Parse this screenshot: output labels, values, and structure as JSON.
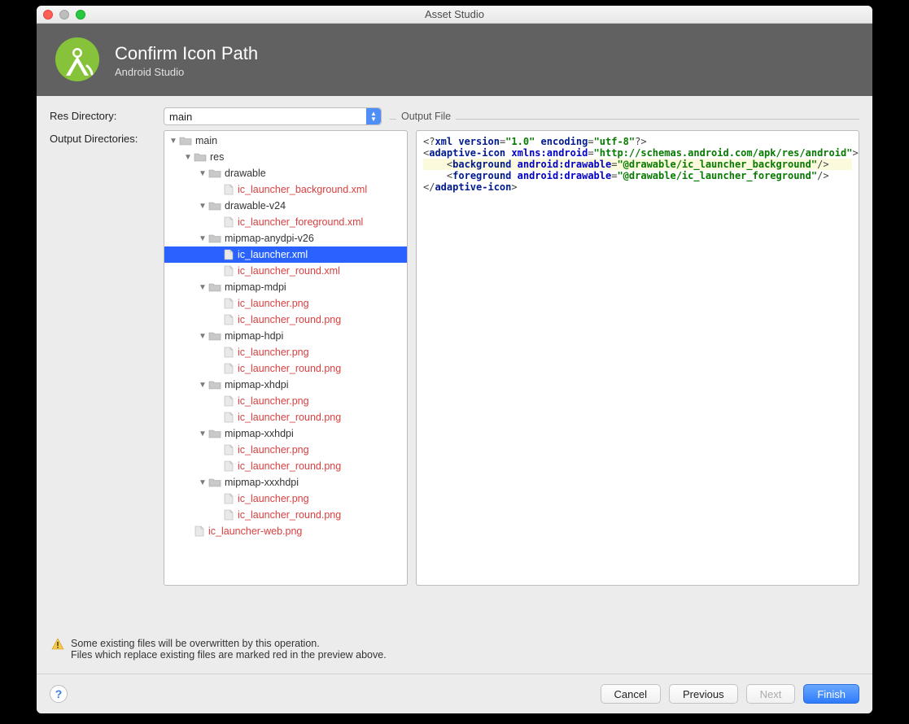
{
  "window": {
    "title": "Asset Studio"
  },
  "banner": {
    "title": "Confirm Icon Path",
    "subtitle": "Android Studio"
  },
  "labels": {
    "res_directory": "Res Directory:",
    "output_directories": "Output Directories:",
    "output_file": "Output File"
  },
  "res_select": {
    "value": "main"
  },
  "tree": [
    {
      "depth": 0,
      "expand": "open",
      "type": "folder",
      "label": "main",
      "red": false
    },
    {
      "depth": 1,
      "expand": "open",
      "type": "folder",
      "label": "res",
      "red": false
    },
    {
      "depth": 2,
      "expand": "open",
      "type": "folder",
      "label": "drawable",
      "red": false
    },
    {
      "depth": 3,
      "expand": "none",
      "type": "file",
      "label": "ic_launcher_background.xml",
      "red": true
    },
    {
      "depth": 2,
      "expand": "open",
      "type": "folder",
      "label": "drawable-v24",
      "red": false
    },
    {
      "depth": 3,
      "expand": "none",
      "type": "file",
      "label": "ic_launcher_foreground.xml",
      "red": true
    },
    {
      "depth": 2,
      "expand": "open",
      "type": "folder",
      "label": "mipmap-anydpi-v26",
      "red": false
    },
    {
      "depth": 3,
      "expand": "none",
      "type": "file",
      "label": "ic_launcher.xml",
      "red": false,
      "selected": true
    },
    {
      "depth": 3,
      "expand": "none",
      "type": "file",
      "label": "ic_launcher_round.xml",
      "red": true
    },
    {
      "depth": 2,
      "expand": "open",
      "type": "folder",
      "label": "mipmap-mdpi",
      "red": false
    },
    {
      "depth": 3,
      "expand": "none",
      "type": "file",
      "label": "ic_launcher.png",
      "red": true
    },
    {
      "depth": 3,
      "expand": "none",
      "type": "file",
      "label": "ic_launcher_round.png",
      "red": true
    },
    {
      "depth": 2,
      "expand": "open",
      "type": "folder",
      "label": "mipmap-hdpi",
      "red": false
    },
    {
      "depth": 3,
      "expand": "none",
      "type": "file",
      "label": "ic_launcher.png",
      "red": true
    },
    {
      "depth": 3,
      "expand": "none",
      "type": "file",
      "label": "ic_launcher_round.png",
      "red": true
    },
    {
      "depth": 2,
      "expand": "open",
      "type": "folder",
      "label": "mipmap-xhdpi",
      "red": false
    },
    {
      "depth": 3,
      "expand": "none",
      "type": "file",
      "label": "ic_launcher.png",
      "red": true
    },
    {
      "depth": 3,
      "expand": "none",
      "type": "file",
      "label": "ic_launcher_round.png",
      "red": true
    },
    {
      "depth": 2,
      "expand": "open",
      "type": "folder",
      "label": "mipmap-xxhdpi",
      "red": false
    },
    {
      "depth": 3,
      "expand": "none",
      "type": "file",
      "label": "ic_launcher.png",
      "red": true
    },
    {
      "depth": 3,
      "expand": "none",
      "type": "file",
      "label": "ic_launcher_round.png",
      "red": true
    },
    {
      "depth": 2,
      "expand": "open",
      "type": "folder",
      "label": "mipmap-xxxhdpi",
      "red": false
    },
    {
      "depth": 3,
      "expand": "none",
      "type": "file",
      "label": "ic_launcher.png",
      "red": true
    },
    {
      "depth": 3,
      "expand": "none",
      "type": "file",
      "label": "ic_launcher_round.png",
      "red": true
    },
    {
      "depth": 1,
      "expand": "none",
      "type": "file",
      "label": "ic_launcher-web.png",
      "red": true
    }
  ],
  "xml": {
    "line1_a": "<?",
    "line1_b": "xml version",
    "line1_c": "=",
    "line1_d": "\"1.0\"",
    "line1_e": " encoding",
    "line1_f": "=",
    "line1_g": "\"utf-8\"",
    "line1_h": "?>",
    "line2_tag": "adaptive-icon",
    "line2_attr": "xmlns:android",
    "line2_val": "\"http://schemas.android.com/apk/res/android\"",
    "line3_tag": "background",
    "line3_attr": "android:drawable",
    "line3_val": "\"@drawable/ic_launcher_background\"",
    "line4_tag": "foreground",
    "line4_attr": "android:drawable",
    "line4_val": "\"@drawable/ic_launcher_foreground\"",
    "line5_tag": "adaptive-icon"
  },
  "warning": {
    "line1": "Some existing files will be overwritten by this operation.",
    "line2": "Files which replace existing files are marked red in the preview above."
  },
  "buttons": {
    "help": "?",
    "cancel": "Cancel",
    "previous": "Previous",
    "next": "Next",
    "finish": "Finish"
  }
}
